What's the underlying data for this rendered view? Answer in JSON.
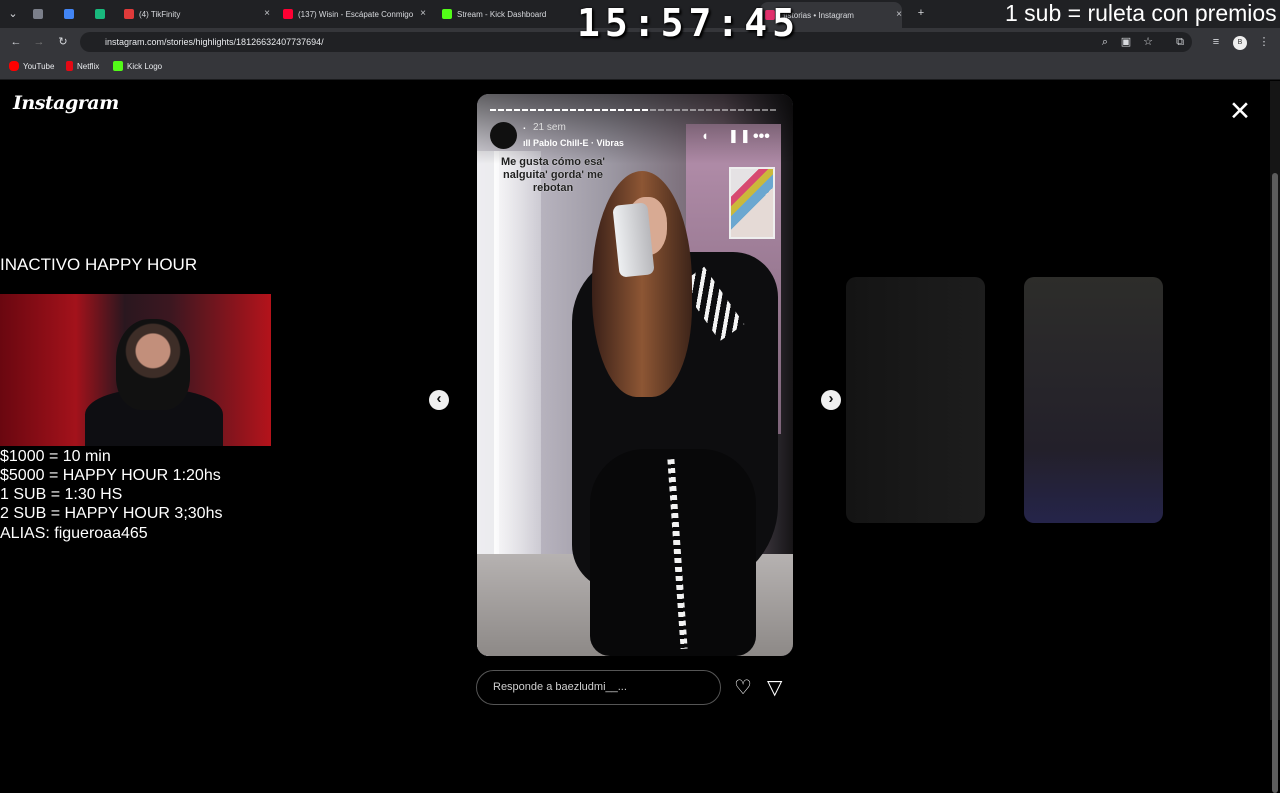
{
  "browser": {
    "tabs": [
      {
        "label": "",
        "favicon_color": "#7b7f8a"
      },
      {
        "label": "",
        "favicon_color": "#4285f4"
      },
      {
        "label": "",
        "favicon_color": "#2b6fe6"
      },
      {
        "label": "",
        "favicon_color": "#19b97d"
      },
      {
        "label": "(4) TikFinity",
        "favicon_color": "#e03a3a"
      },
      {
        "label": "(137) Wisin - Escápate Conmigo",
        "favicon_color": "#ff0033"
      },
      {
        "label": "Stream - Kick Dashboard",
        "favicon_color": "#53fc18"
      },
      {
        "label": "Historias • Instagram",
        "favicon_color": "#e1306c"
      }
    ],
    "address": "instagram.com/stories/highlights/18126632407737694/",
    "bookmarks": [
      {
        "label": "YouTube",
        "icon_color": "#ff0000"
      },
      {
        "label": "Netflix",
        "icon_color": "#e50914"
      },
      {
        "label": "Kick Logo",
        "icon_color": "#53fc18"
      }
    ]
  },
  "stream_overlay": {
    "clock": "15:57:45",
    "promo": "1 sub = ruleta con premios",
    "status": "INACTIVO HAPPY HOUR",
    "rules": [
      "$1000 = 10 min",
      "$5000 = HAPPY HOUR 1:20hs",
      "1 SUB = 1:30 HS",
      "2 SUB = HAPPY HOUR 3;30hs",
      "ALIAS: figueroaa465"
    ]
  },
  "instagram": {
    "logo": "Instagram",
    "story": {
      "username": ".",
      "posted": "21 sem",
      "music": "Pablo Chill-E · Vibras",
      "caption": "Me gusta cómo esa' nalguita' gorda' me rebotan",
      "progress": 0.55
    },
    "reply_placeholder": "Responde a baezludmi__..."
  },
  "icons": {
    "volume": "volume-icon",
    "pause": "pause-icon",
    "more": "more-icon",
    "previous": "chevron-left-icon",
    "next": "chevron-right-icon",
    "close": "close-icon",
    "like": "heart-icon",
    "send": "send-icon"
  }
}
